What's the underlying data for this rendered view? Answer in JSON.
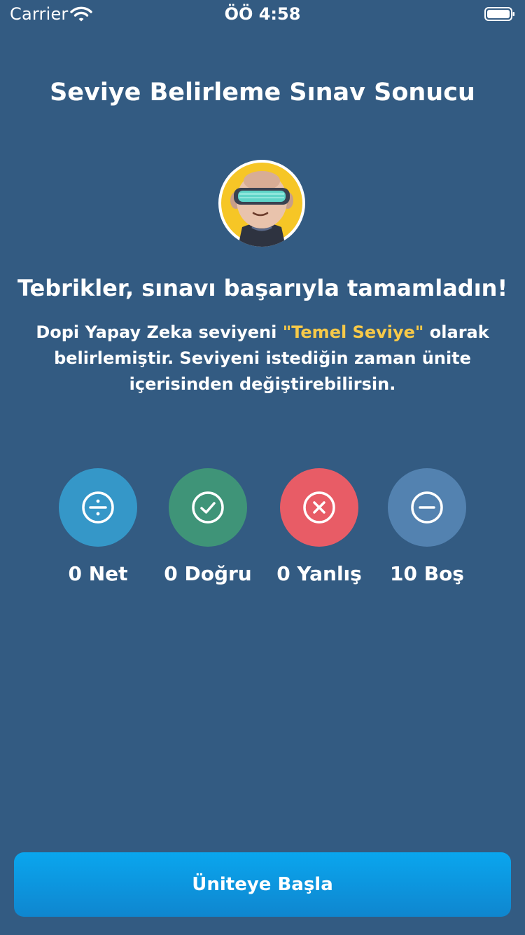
{
  "status_bar": {
    "carrier": "Carrier",
    "time": "ÖÖ 4:58"
  },
  "page": {
    "title": "Seviye Belirleme Sınav Sonucu",
    "headline": "Tebrikler, sınavı başarıyla tamamladın!",
    "description_before": "Dopi Yapay Zeka seviyeni ",
    "level_highlight": "\"Temel Seviye\"",
    "description_after": " olarak belirlemiştir. Seviyeni istediğin zaman ünite içerisinden değiştirebilirsin.",
    "highlight_color": "#f7c948"
  },
  "stats": [
    {
      "label": "0 Net",
      "icon": "divide-icon",
      "color": "#3597c8"
    },
    {
      "label": "0 Doğru",
      "icon": "check-circle-icon",
      "color": "#3f9478"
    },
    {
      "label": "0 Yanlış",
      "icon": "x-circle-icon",
      "color": "#e85c66"
    },
    {
      "label": "10 Boş",
      "icon": "minus-circle-icon",
      "color": "#5382b0"
    }
  ],
  "actions": {
    "start_button_label": "Üniteye Başla"
  },
  "colors": {
    "background": "#335b82",
    "button": "#0aa6ee"
  }
}
